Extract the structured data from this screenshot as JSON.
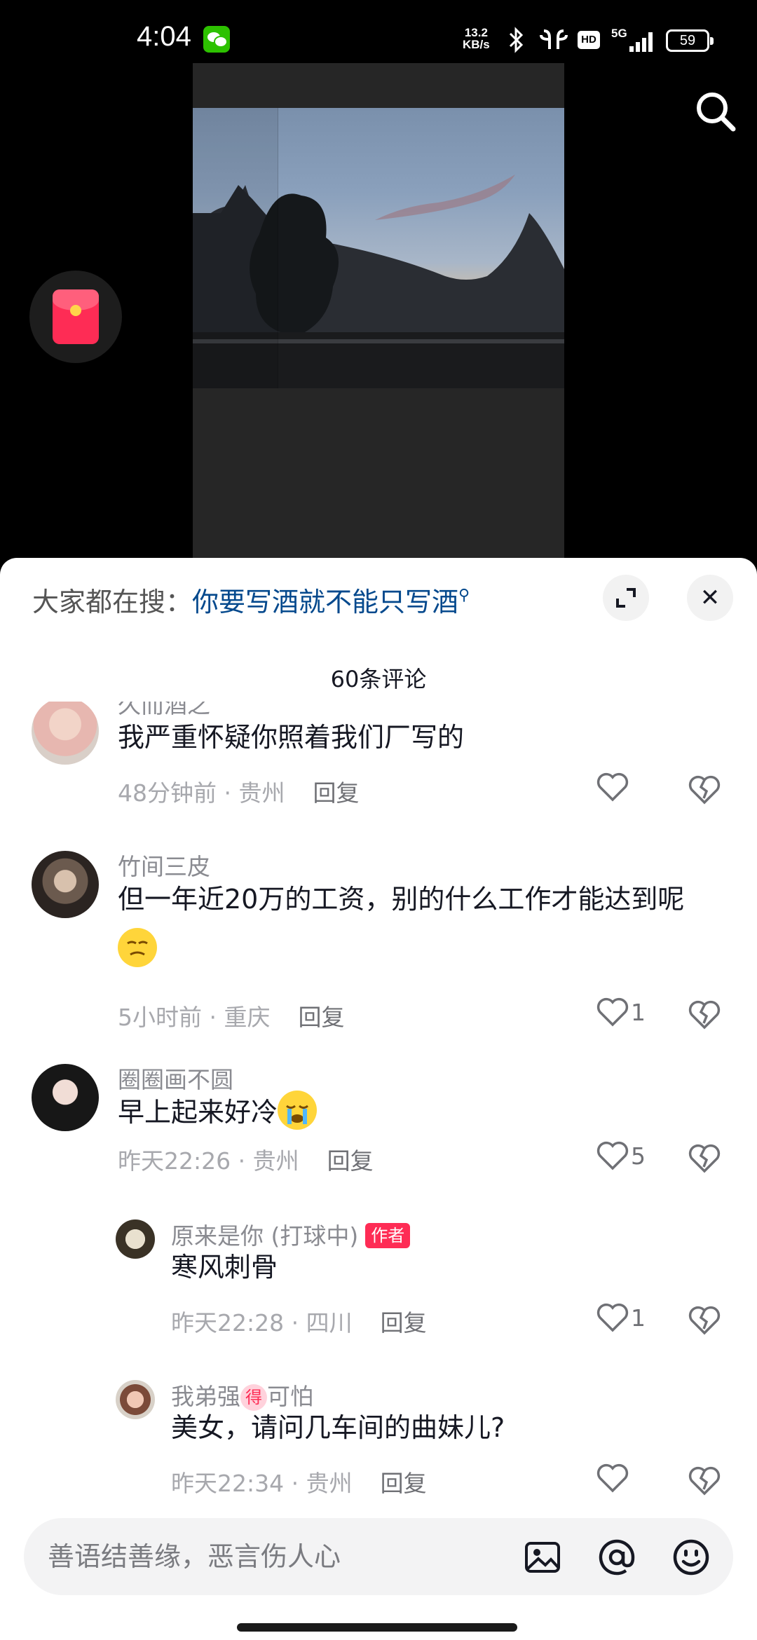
{
  "status_bar": {
    "time": "4:04",
    "net_speed_value": "13.2",
    "net_speed_unit": "KB/s",
    "hd": "HD",
    "network": "5G",
    "battery": "59"
  },
  "icons": {
    "wechat": "wechat-icon",
    "bluetooth": "bluetooth-icon",
    "earbuds": "earbuds-icon",
    "search": "search-icon",
    "red_packet": "red-packet-icon",
    "expand": "expand-icon",
    "close": "close-icon",
    "heart": "heart-icon",
    "dislike": "broken-heart-icon",
    "image": "image-icon",
    "at": "at-icon",
    "emoji": "emoji-icon"
  },
  "sheet": {
    "hot_search_label": "大家都在搜：",
    "hot_search_keyword": "你要写酒就不能只写酒",
    "title": "60条评论",
    "close_glyph": "✕"
  },
  "comments": [
    {
      "username": "久而酒之",
      "text": "我严重怀疑你照着我们厂写的",
      "time": "48分钟前",
      "location": "贵州",
      "reply": "回复",
      "likes": ""
    },
    {
      "username": "竹间三皮",
      "text": "但一年近20万的工资，别的什么工作才能达到呢",
      "time": "5小时前",
      "location": "重庆",
      "reply": "回复",
      "likes": "1"
    },
    {
      "username": "圈圈画不圆",
      "text": "早上起来好冷",
      "time": "昨天22:26",
      "location": "贵州",
      "reply": "回复",
      "likes": "5"
    }
  ],
  "replies": [
    {
      "username": "原来是你 (打球中)",
      "tag": "作者",
      "text": "寒风刺骨",
      "time": "昨天22:28",
      "location": "四川",
      "reply": "回复",
      "likes": "1"
    },
    {
      "username_before": "我弟强",
      "badge": "得",
      "username_after": "可怕",
      "text": "美女，请问几车间的曲妹儿?",
      "time": "昨天22:34",
      "location": "贵州",
      "reply": "回复",
      "likes": ""
    }
  ],
  "meta_separator": " · ",
  "input": {
    "placeholder": "善语结善缘，恶言伤人心"
  },
  "colors": {
    "accent": "#fe2c55",
    "keyword": "#04498d",
    "wechat_green": "#2dc100"
  }
}
